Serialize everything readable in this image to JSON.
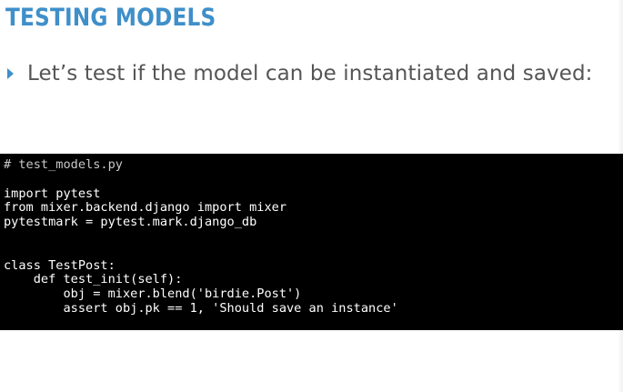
{
  "slide": {
    "title": "TESTING MODELS",
    "bullet": "Let’s test if the model can be instantiated and saved:",
    "accent_color": "#3f8fc9",
    "bullet_icon": "triangle-right-icon"
  },
  "code": {
    "lines": [
      "# test_models.py",
      "",
      "import pytest",
      "from mixer.backend.django import mixer",
      "pytestmark = pytest.mark.django_db",
      "",
      "",
      "class TestPost:",
      "    def test_init(self):",
      "        obj = mixer.blend('birdie.Post')",
      "        assert obj.pk == 1, 'Should save an instance'"
    ],
    "background": "#000000"
  }
}
